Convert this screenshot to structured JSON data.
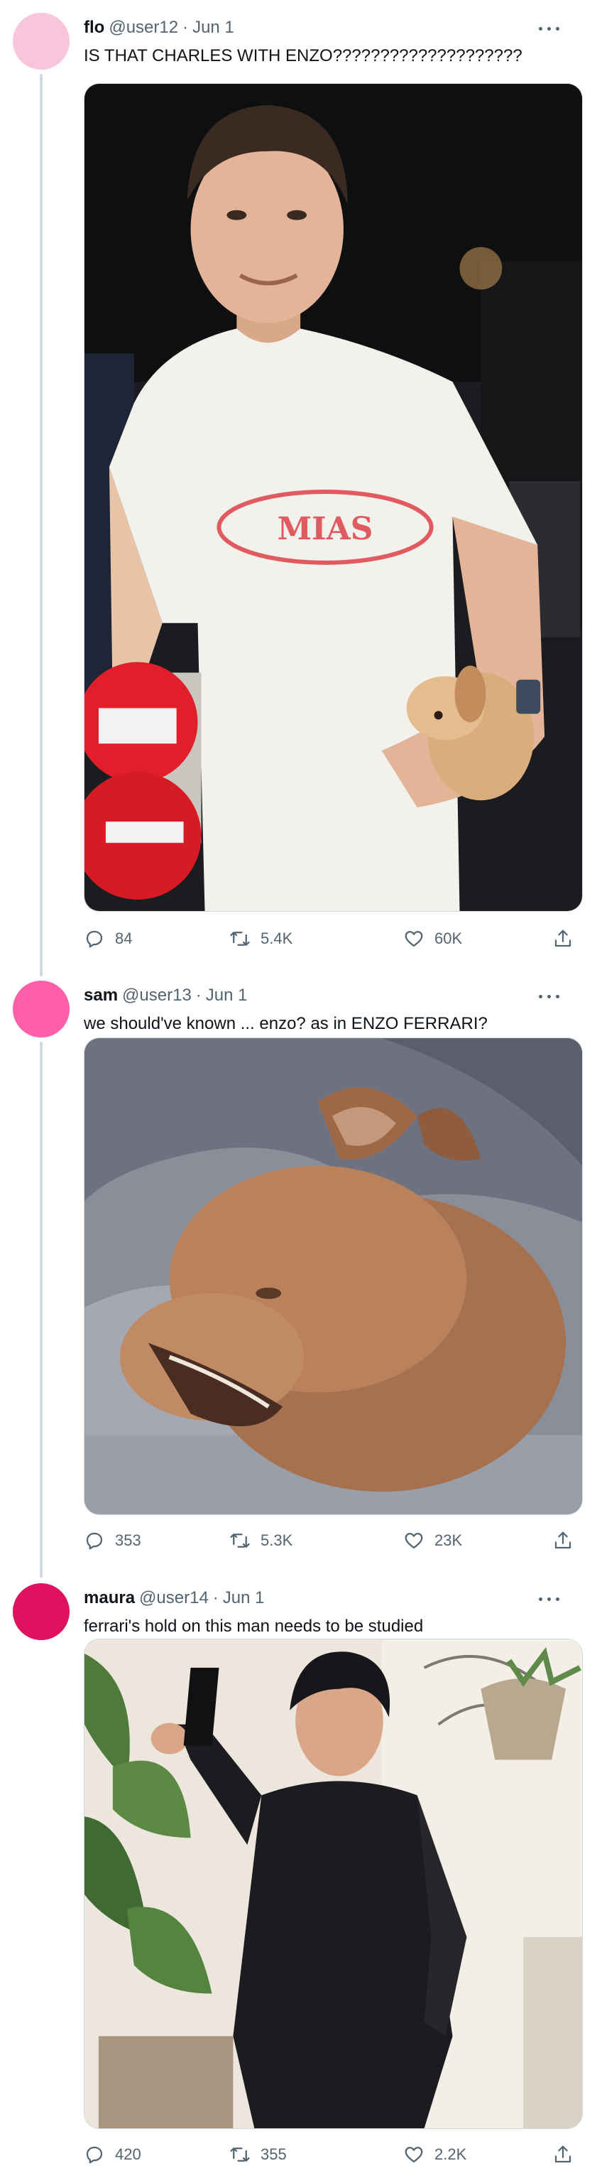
{
  "tweets": [
    {
      "name": "flo",
      "handle": "@user12",
      "separator": "·",
      "date": "Jun 1",
      "text": "IS THAT CHARLES WITH ENZO????????????????????",
      "avatar_color": "#f7c6da",
      "media_description_icon": "photo-man-holding-puppy",
      "shirt_logo": "MIAS",
      "reply_count": "84",
      "retweet_count": "5.4K",
      "like_count": "60K"
    },
    {
      "name": "sam",
      "handle": "@user13",
      "separator": "·",
      "date": "Jun 1",
      "text": "we should've known ... enzo? as in ENZO FERRARI?",
      "avatar_color": "#ff5fa8",
      "media_description_icon": "photo-puppy-yawning",
      "reply_count": "353",
      "retweet_count": "5.3K",
      "like_count": "23K"
    },
    {
      "name": "maura",
      "handle": "@user14",
      "separator": "·",
      "date": "Jun 1",
      "text": "ferrari's hold on this man needs to be studied",
      "avatar_color": "#e0115f",
      "media_description_icon": "photo-woman-holding-gun",
      "reply_count": "420",
      "retweet_count": "355",
      "like_count": "2.2K"
    }
  ],
  "colors": {
    "text_primary": "#0f1419",
    "text_secondary": "#536471",
    "thread_line": "#cfd9de",
    "border": "#cfd9de"
  },
  "icons": {
    "reply": "reply-icon",
    "retweet": "retweet-icon",
    "like": "heart-icon",
    "share": "share-icon",
    "more": "more-dots-icon"
  }
}
